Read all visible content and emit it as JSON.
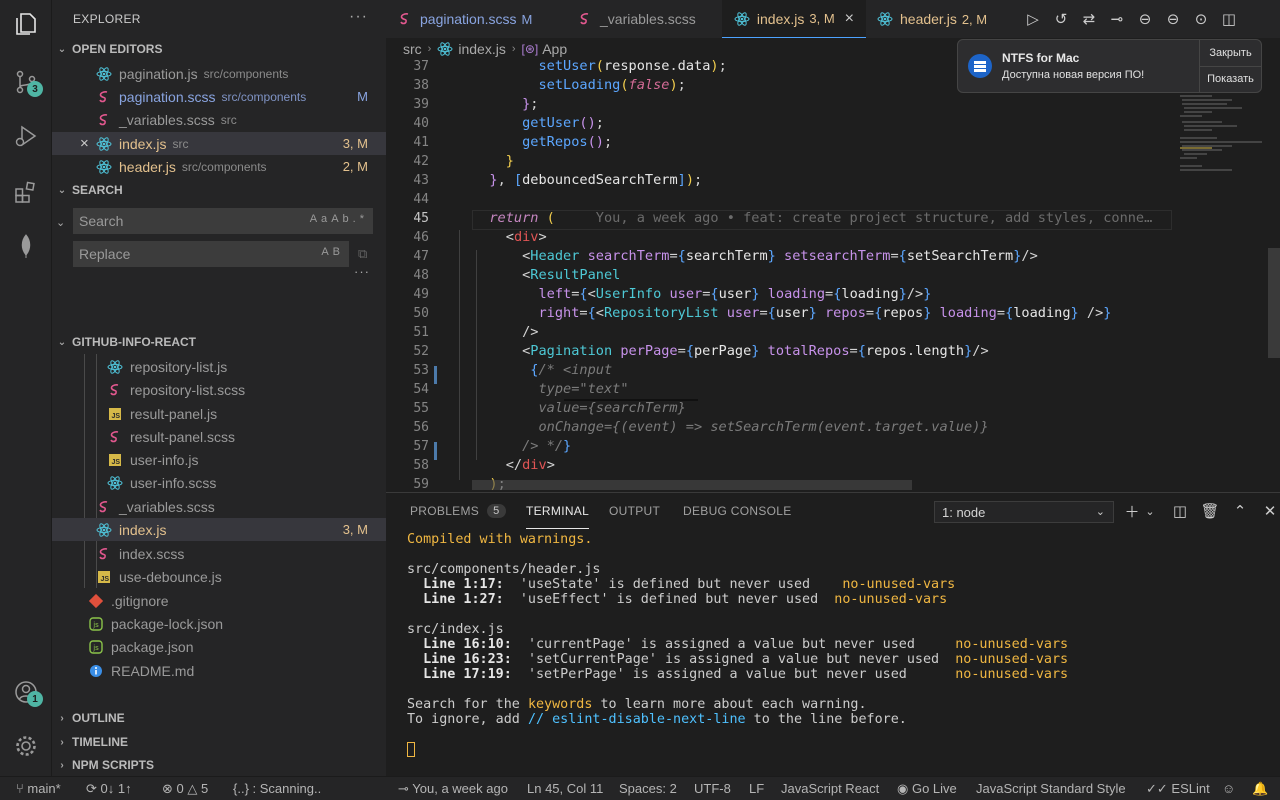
{
  "activity": {
    "scm_badge": "3",
    "account_badge": "1"
  },
  "sidebar": {
    "title": "EXPLORER",
    "open_editors": {
      "label": "OPEN EDITORS",
      "items": [
        {
          "name": "pagination.js",
          "path": "src/components",
          "status": ""
        },
        {
          "name": "pagination.scss",
          "path": "src/components",
          "status": "M"
        },
        {
          "name": "_variables.scss",
          "path": "src",
          "status": ""
        },
        {
          "name": "index.js",
          "path": "src",
          "status": "3, M"
        },
        {
          "name": "header.js",
          "path": "src/components",
          "status": "2, M"
        }
      ]
    },
    "search": {
      "label": "SEARCH",
      "placeholder": "Search",
      "replace_placeholder": "Replace",
      "opt1": "Aa",
      "opt2": "Ab",
      "opt3": ".*",
      "replace_opt": "AB"
    },
    "project": {
      "label": "GITHUB-INFO-REACT",
      "files": [
        {
          "name": "repository-list.js"
        },
        {
          "name": "repository-list.scss"
        },
        {
          "name": "result-panel.js"
        },
        {
          "name": "result-panel.scss"
        },
        {
          "name": "user-info.js"
        },
        {
          "name": "user-info.scss"
        },
        {
          "name": "_variables.scss"
        },
        {
          "name": "index.js",
          "status": "3, M"
        },
        {
          "name": "index.scss"
        },
        {
          "name": "use-debounce.js"
        },
        {
          "name": ".gitignore"
        },
        {
          "name": "package-lock.json"
        },
        {
          "name": "package.json"
        },
        {
          "name": "README.md"
        }
      ]
    },
    "outline": "OUTLINE",
    "timeline": "TIMELINE",
    "npm": "NPM SCRIPTS"
  },
  "tabs": [
    {
      "name": "pagination.scss",
      "status": "M"
    },
    {
      "name": "_variables.scss",
      "status": ""
    },
    {
      "name": "index.js",
      "status": "3, M",
      "close": "×"
    },
    {
      "name": "header.js",
      "status": "2, M"
    }
  ],
  "breadcrumb": {
    "folder": "src",
    "file": "index.js",
    "symbol": "App"
  },
  "editor": {
    "lines": [
      "37",
      "38",
      "39",
      "40",
      "41",
      "42",
      "43",
      "44",
      "45",
      "46",
      "47",
      "48",
      "49",
      "50",
      "51",
      "52",
      "53",
      "54",
      "55",
      "56",
      "57",
      "58",
      "59"
    ],
    "blame": "You, a week ago • feat: create project structure, add styles, conne…"
  },
  "notification": {
    "title": "NTFS for Mac",
    "message": "Доступна новая версия ПО!",
    "close": "Закрыть",
    "show": "Показать"
  },
  "panel": {
    "tabs": {
      "problems": "PROBLEMS",
      "problems_count": "5",
      "terminal": "TERMINAL",
      "output": "OUTPUT",
      "debug": "DEBUG CONSOLE"
    },
    "terminal_select": "1: node",
    "term": {
      "l1": "Compiled with warnings.",
      "f1": "src/components/header.js",
      "w1a": "Line 1:17:",
      "w1b": "'useState' is defined but never used  ",
      "w1c": "no-unused-vars",
      "w2a": "Line 1:27:",
      "w2b": "'useEffect' is defined but never used ",
      "w2c": "no-unused-vars",
      "f2": "src/index.js",
      "w3a": "Line 16:10:",
      "w3b": "'currentPage' is assigned a value but never used    ",
      "w3c": "no-unused-vars",
      "w4a": "Line 16:23:",
      "w4b": "'setCurrentPage' is assigned a value but never used ",
      "w4c": "no-unused-vars",
      "w5a": "Line 17:19:",
      "w5b": "'setPerPage' is assigned a value but never used     ",
      "w5c": "no-unused-vars",
      "s1a": "Search for the ",
      "s1b": "keywords",
      "s1c": " to learn more about each warning.",
      "s2a": "To ignore, add ",
      "s2b": "// eslint-disable-next-line",
      "s2c": " to the line before."
    }
  },
  "status": {
    "branch": "main*",
    "sync": "0↓ 1↑",
    "problems": "0 △ 5",
    "scanning": "{..} : Scanning..",
    "blame": "You, a week ago",
    "position": "Ln 45, Col 11",
    "spaces": "Spaces: 2",
    "encoding": "UTF-8",
    "eol": "LF",
    "language": "JavaScript React",
    "golive": "Go Live",
    "style": "JavaScript Standard Style",
    "eslint": "ESLint"
  }
}
